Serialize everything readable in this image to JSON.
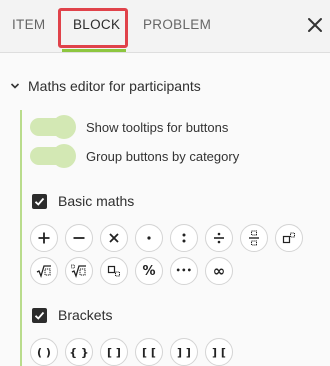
{
  "tabs": [
    {
      "label": "ITEM"
    },
    {
      "label": "BLOCK",
      "active": true
    },
    {
      "label": "PROBLEM"
    }
  ],
  "close_icon": "close-icon",
  "accent_color": "#8dc63f",
  "highlight_color": "#e0424a",
  "section": {
    "title": "Maths editor for participants",
    "expanded": true
  },
  "toggles": [
    {
      "label": "Show tooltips for buttons",
      "on": true
    },
    {
      "label": "Group buttons by category",
      "on": true
    }
  ],
  "groups": [
    {
      "label": "Basic maths",
      "checked": true,
      "buttons": [
        {
          "icon": "plus-icon"
        },
        {
          "icon": "minus-icon"
        },
        {
          "icon": "times-icon"
        },
        {
          "icon": "dot-icon"
        },
        {
          "icon": "colon-icon"
        },
        {
          "icon": "divide-icon"
        },
        {
          "icon": "fraction-icon"
        },
        {
          "icon": "superscript-icon"
        },
        {
          "icon": "square-root-icon"
        },
        {
          "icon": "nth-root-icon"
        },
        {
          "icon": "subscript-icon"
        },
        {
          "icon": "percent-icon",
          "glyph": "%"
        },
        {
          "icon": "ellipsis-icon",
          "glyph": "•••"
        },
        {
          "icon": "infinity-icon",
          "glyph": "∞"
        }
      ]
    },
    {
      "label": "Brackets",
      "checked": true,
      "buttons": [
        {
          "icon": "parentheses-icon",
          "glyph": "( )"
        },
        {
          "icon": "braces-icon",
          "glyph": "{ }"
        },
        {
          "icon": "square-brackets-icon",
          "glyph": "[ ]"
        },
        {
          "icon": "open-open-brackets-icon",
          "glyph": "[ ["
        },
        {
          "icon": "close-close-brackets-icon",
          "glyph": "] ]"
        },
        {
          "icon": "reversed-brackets-icon",
          "glyph": "] ["
        }
      ]
    }
  ]
}
